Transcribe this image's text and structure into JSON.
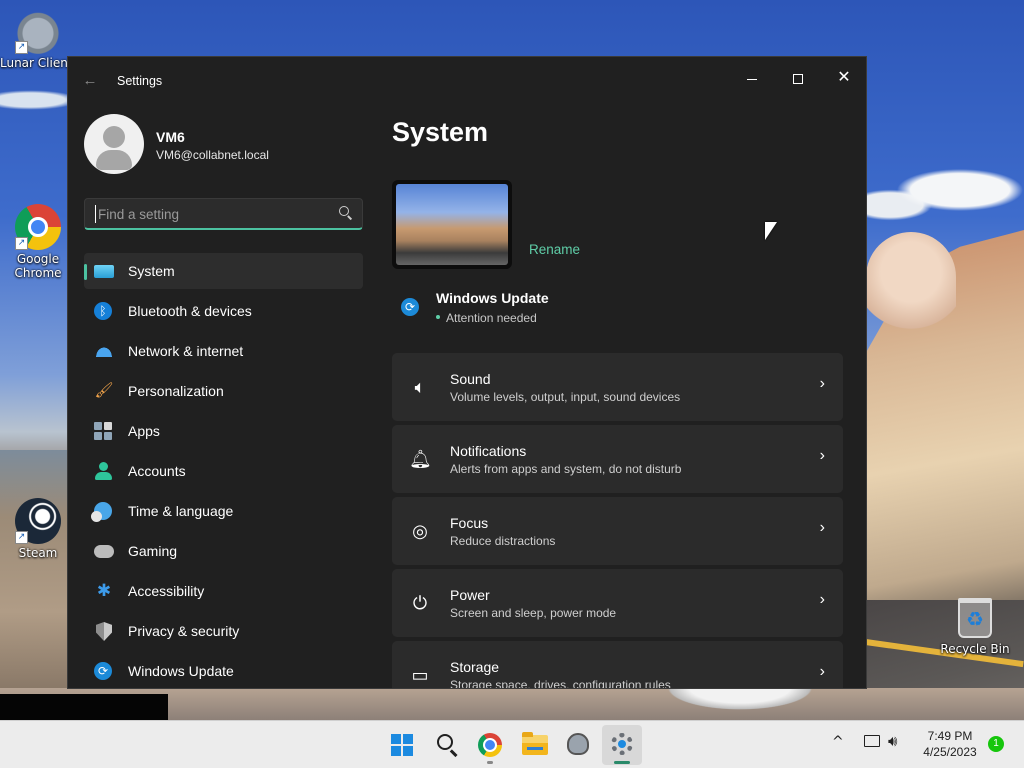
{
  "desktop": {
    "icons": [
      {
        "label": "Lunar Client"
      },
      {
        "label": "Google Chrome"
      },
      {
        "label": "Steam"
      },
      {
        "label": "Recycle Bin"
      }
    ]
  },
  "window": {
    "title": "Settings",
    "back_glyph": "←",
    "controls": {
      "minimize": "minimize",
      "maximize": "maximize",
      "close": "✕"
    }
  },
  "profile": {
    "name": "VM6",
    "email": "VM6@collabnet.local"
  },
  "search": {
    "placeholder": "Find a setting",
    "value": ""
  },
  "nav": {
    "items": [
      {
        "label": "System",
        "icon": "monitor-icon",
        "active": true
      },
      {
        "label": "Bluetooth & devices",
        "icon": "bluetooth-icon"
      },
      {
        "label": "Network & internet",
        "icon": "wifi-icon"
      },
      {
        "label": "Personalization",
        "icon": "brush-icon"
      },
      {
        "label": "Apps",
        "icon": "apps-icon"
      },
      {
        "label": "Accounts",
        "icon": "person-icon"
      },
      {
        "label": "Time & language",
        "icon": "globe-clock-icon"
      },
      {
        "label": "Gaming",
        "icon": "gamepad-icon"
      },
      {
        "label": "Accessibility",
        "icon": "accessibility-icon"
      },
      {
        "label": "Privacy & security",
        "icon": "shield-icon"
      },
      {
        "label": "Windows Update",
        "icon": "sync-icon"
      }
    ]
  },
  "main": {
    "title": "System",
    "rename_label": "Rename",
    "windows_update": {
      "title": "Windows Update",
      "status": "Attention needed"
    },
    "cards": [
      {
        "title": "Sound",
        "description": "Volume levels, output, input, sound devices",
        "icon": "speaker-icon"
      },
      {
        "title": "Notifications",
        "description": "Alerts from apps and system, do not disturb",
        "icon": "bell-icon"
      },
      {
        "title": "Focus",
        "description": "Reduce distractions",
        "icon": "focus-icon"
      },
      {
        "title": "Power",
        "description": "Screen and sleep, power mode",
        "icon": "power-icon"
      },
      {
        "title": "Storage",
        "description": "Storage space, drives, configuration rules",
        "icon": "storage-icon"
      }
    ],
    "chevron": "›"
  },
  "taskbar": {
    "apps": [
      "start-icon",
      "search-icon",
      "chrome-icon",
      "file-explorer-icon",
      "lunar-client-icon",
      "settings-icon"
    ],
    "tray_chevron": "^",
    "time": "7:49 PM",
    "date": "4/25/2023",
    "notification_count": "1"
  },
  "colors": {
    "accent": "#4cc2a1",
    "window_bg": "#202020",
    "card_bg": "#2b2b2b",
    "taskbar_bg": "#ececec"
  }
}
